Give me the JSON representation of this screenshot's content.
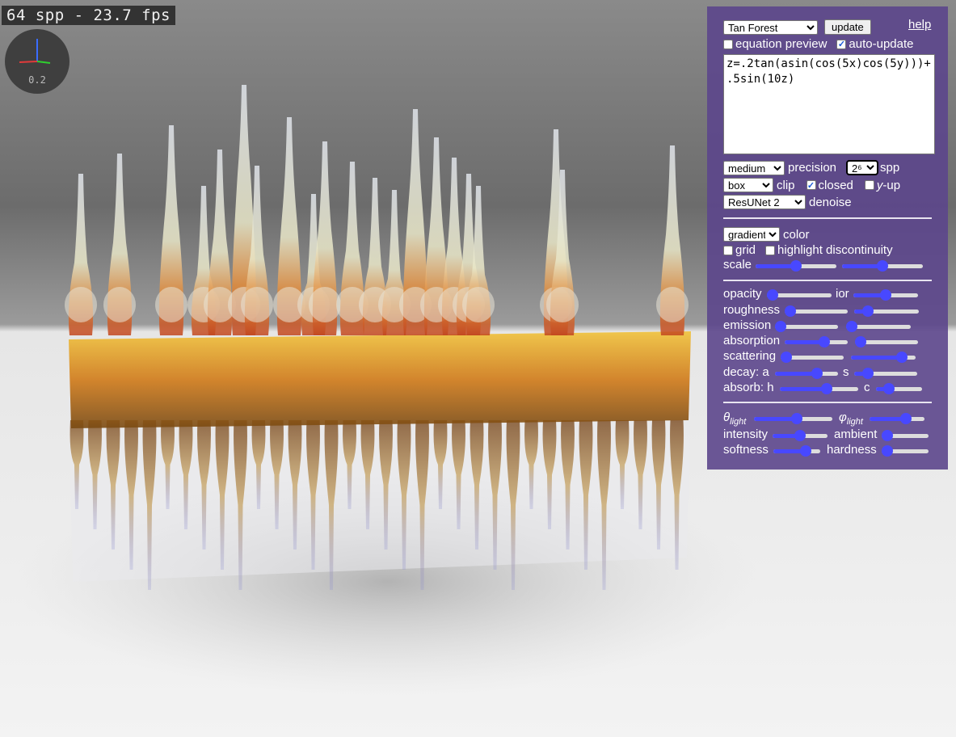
{
  "status": {
    "fps_text": "64 spp - 23.7 fps"
  },
  "axes_widget": {
    "scale_label": "0.2"
  },
  "panel": {
    "preset": {
      "selected": "Tan Forest"
    },
    "update_label": "update",
    "help_label": "help",
    "equation_preview": {
      "label": "equation preview",
      "checked": false
    },
    "auto_update": {
      "label": "auto-update",
      "checked": true
    },
    "equation": "z=.2tan(asin(cos(5x)cos(5y)))+.5sin(10z)",
    "precision": {
      "selected": "medium",
      "label": "precision"
    },
    "spp": {
      "selected": "2⁶",
      "label": "spp"
    },
    "clip": {
      "selected": "box",
      "label": "clip"
    },
    "closed": {
      "label": "closed",
      "checked": true
    },
    "y_up": {
      "label_y": "y",
      "label_rest": "-up",
      "checked": false
    },
    "denoise": {
      "selected": "ResUNet 2",
      "label": "denoise"
    },
    "color": {
      "selected": "gradient",
      "label": "color"
    },
    "grid": {
      "label": "grid",
      "checked": false
    },
    "highlight": {
      "label": "highlight discontinuity",
      "checked": false
    },
    "labels": {
      "scale": "scale",
      "opacity": "opacity",
      "ior": "ior",
      "roughness": "roughness",
      "emission": "emission",
      "absorption": "absorption",
      "scattering": "scattering",
      "decay_a": "decay: a",
      "s": "s",
      "absorb_h": "absorb: h",
      "c": "c",
      "theta": "θ",
      "phi": "φ",
      "light_sub": "light",
      "intensity": "intensity",
      "ambient": "ambient",
      "softness": "softness",
      "hardness": "hardness"
    },
    "slider_values": {
      "scale_1": 0.5,
      "scale_2": 0.5,
      "opacity": 0.0,
      "ior": 0.5,
      "roughness": 0.0,
      "roughness_2": 0.15,
      "emission": 0.0,
      "emission_2": 0.0,
      "absorption": 0.65,
      "absorption_2": 0.0,
      "scattering": 0.0,
      "scattering_2": 0.85,
      "decay_a": 0.7,
      "s": 0.15,
      "absorb_h": 0.62,
      "c": 0.2,
      "theta": 0.55,
      "phi": 0.7,
      "intensity": 0.5,
      "ambient": 0.0,
      "softness": 0.75,
      "hardness": 0.0
    }
  }
}
